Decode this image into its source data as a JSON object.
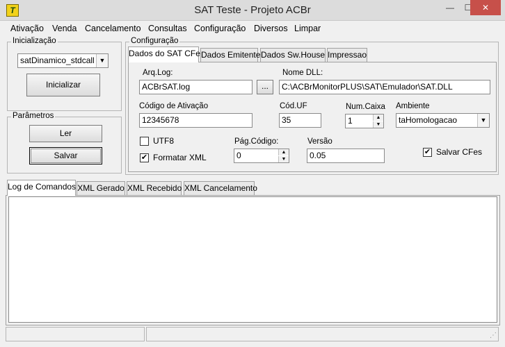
{
  "window": {
    "title": "SAT Teste - Projeto ACBr",
    "icon_text": "T",
    "minimize_glyph": "—",
    "maximize_glyph": "☐",
    "close_glyph": "✕"
  },
  "menu": {
    "items": [
      "Ativação",
      "Venda",
      "Cancelamento",
      "Consultas",
      "Configuração",
      "Diversos",
      "Limpar"
    ]
  },
  "inicializacao": {
    "legend": "Inicialização",
    "lib_select": "satDinamico_stdcall",
    "init_button": "Inicializar"
  },
  "parametros": {
    "legend": "Parâmetros",
    "ler_button": "Ler",
    "salvar_button": "Salvar"
  },
  "configuracao": {
    "legend": "Configuração",
    "tabs": [
      "Dados do SAT CFe",
      "Dados Emitente",
      "Dados Sw.House",
      "Impressao"
    ],
    "arq_log_label": "Arq.Log:",
    "arq_log_value": "ACBrSAT.log",
    "browse_button": "...",
    "nome_dll_label": "Nome DLL:",
    "nome_dll_value": "C:\\ACBrMonitorPLUS\\SAT\\Emulador\\SAT.DLL",
    "codigo_ativacao_label": "Código de Ativação",
    "codigo_ativacao_value": "12345678",
    "cod_uf_label": "Cód.UF",
    "cod_uf_value": "35",
    "num_caixa_label": "Num.Caixa",
    "num_caixa_value": "1",
    "ambiente_label": "Ambiente",
    "ambiente_value": "taHomologacao",
    "utf8_label": "UTF8",
    "utf8_checked": false,
    "formatar_xml_label": "Formatar XML",
    "formatar_xml_checked": true,
    "pag_codigo_label": "Pág.Código:",
    "pag_codigo_value": "0",
    "versao_label": "Versão",
    "versao_value": "0.05",
    "salvar_cfes_label": "Salvar CFes",
    "salvar_cfes_checked": true
  },
  "bottom_tabs": [
    "Log de Comandos",
    "XML Gerado",
    "XML Recebido",
    "XML Cancelamento"
  ],
  "glyphs": {
    "check": "✔",
    "dropdown": "▼",
    "spin_up": "▲",
    "spin_down": "▼",
    "grip": "⋰"
  }
}
